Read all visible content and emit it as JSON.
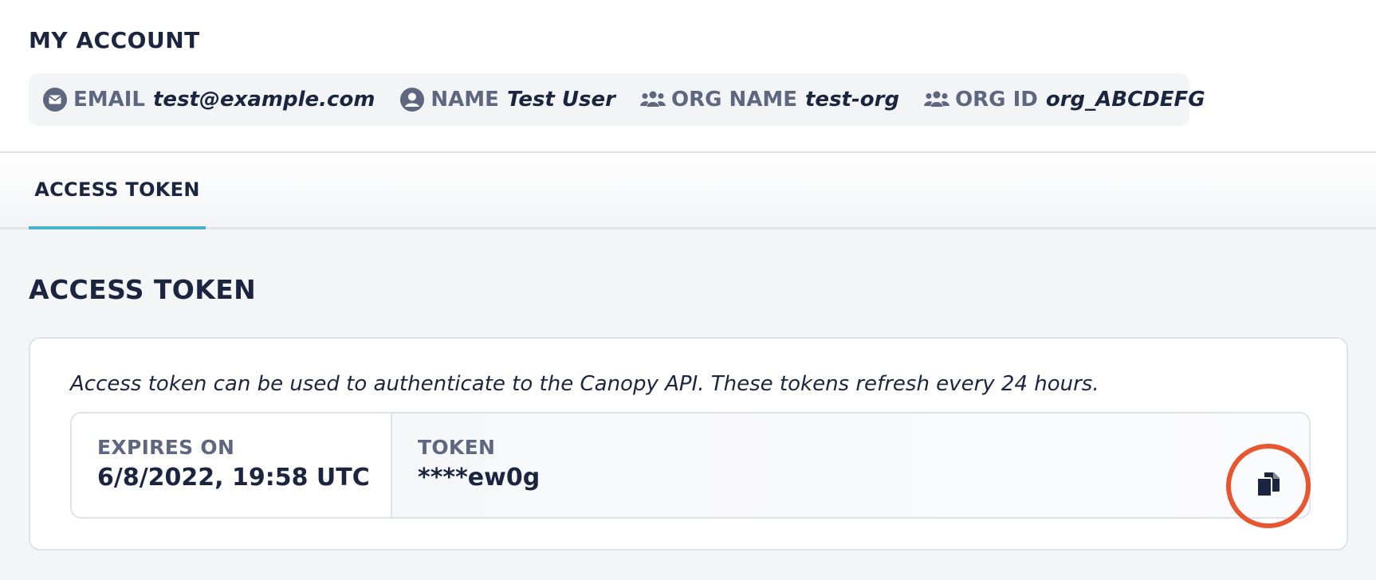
{
  "header": {
    "title": "MY ACCOUNT"
  },
  "account_info": [
    {
      "icon": "envelope-icon",
      "label": "EMAIL",
      "value": "test@example.com"
    },
    {
      "icon": "user-circle-icon",
      "label": "NAME",
      "value": "Test User"
    },
    {
      "icon": "users-icon",
      "label": "ORG NAME",
      "value": "test-org"
    },
    {
      "icon": "users-icon",
      "label": "ORG ID",
      "value": "org_ABCDEFG"
    }
  ],
  "tabs": [
    {
      "label": "ACCESS TOKEN",
      "active": true
    }
  ],
  "section": {
    "title": "ACCESS TOKEN",
    "description": "Access token can be used to authenticate to the Canopy API. These tokens refresh every 24 hours.",
    "expires_label": "EXPIRES ON",
    "expires_value": "6/8/2022, 19:58 UTC",
    "token_label": "TOKEN",
    "token_value": "****ew0g",
    "copy_icon": "copy-icon"
  },
  "colors": {
    "text_dark": "#1c2540",
    "label_gray": "#5f6680",
    "tab_accent": "#4ab0cc",
    "highlight_ring": "#e8562f"
  }
}
